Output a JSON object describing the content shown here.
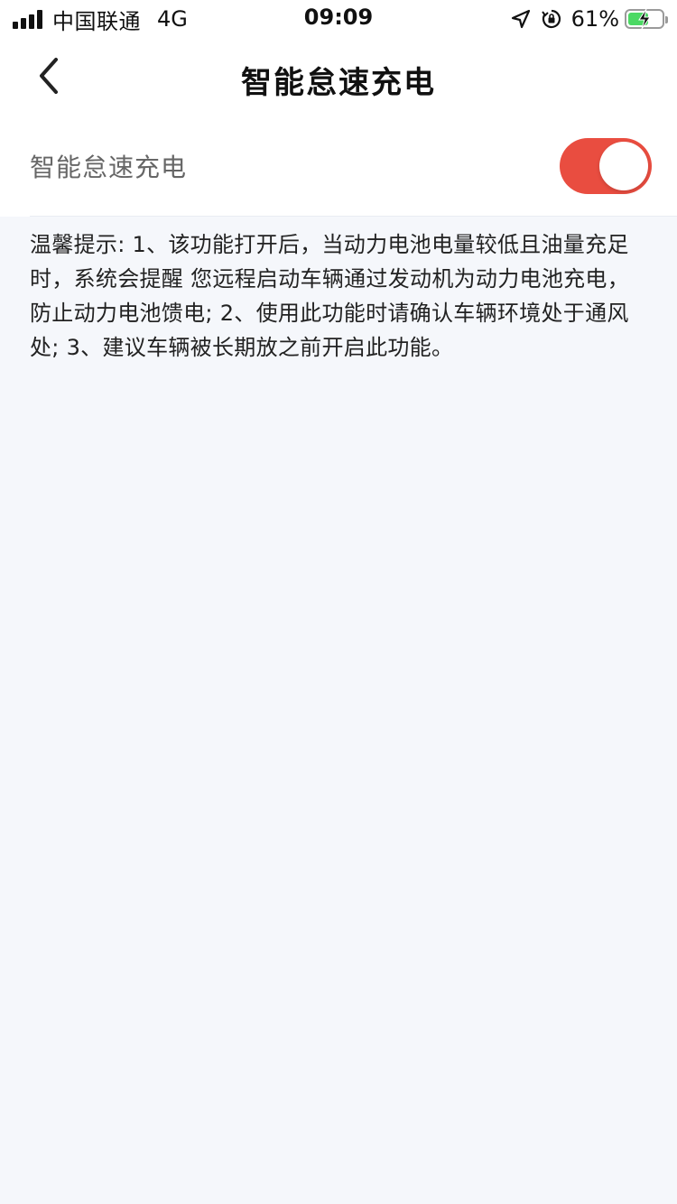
{
  "status_bar": {
    "carrier": "中国联通",
    "network": "4G",
    "time": "09:09",
    "battery_percent": "61%",
    "battery_level": 0.61,
    "icons": [
      "signal-icon",
      "location-icon",
      "orientation-lock-icon",
      "battery-charging-icon"
    ]
  },
  "nav": {
    "title": "智能怠速充电",
    "back_icon": "chevron-left-icon"
  },
  "setting": {
    "label": "智能怠速充电",
    "enabled": true,
    "accent_color": "#e94d40"
  },
  "tip": {
    "text": "温馨提示: 1、该功能打开后，当动力电池电量较低且油量充足时，系统会提醒 您远程启动车辆通过发动机为动力电池充电，防止动力电池馈电; 2、使用此功能时请确认车辆环境处于通风处; 3、建议车辆被长期放之前开启此功能。"
  }
}
